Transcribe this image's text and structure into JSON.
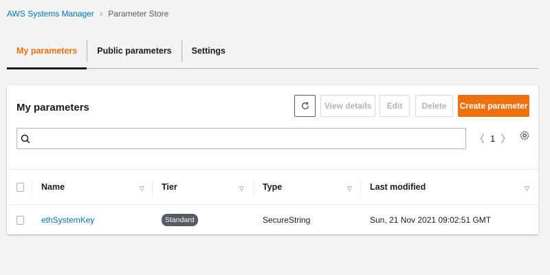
{
  "breadcrumb": {
    "parent": "AWS Systems Manager",
    "current": "Parameter Store"
  },
  "tabs": [
    {
      "label": "My parameters",
      "active": true
    },
    {
      "label": "Public parameters",
      "active": false
    },
    {
      "label": "Settings",
      "active": false
    }
  ],
  "panel": {
    "title": "My parameters",
    "buttons": {
      "view_details": "View details",
      "edit": "Edit",
      "delete": "Delete",
      "create": "Create parameter"
    },
    "search": {
      "placeholder": "",
      "value": ""
    },
    "pagination": {
      "page": "1"
    }
  },
  "table": {
    "columns": [
      "Name",
      "Tier",
      "Type",
      "Last modified"
    ],
    "rows": [
      {
        "name": "ethSystemKey",
        "tier": "Standard",
        "type": "SecureString",
        "last_modified": "Sun, 21 Nov 2021 09:02:51 GMT"
      }
    ]
  },
  "colors": {
    "accent": "#ec7211",
    "link": "#0073bb",
    "background": "#f2f3f3",
    "badge": "#545b64"
  },
  "icons": [
    "chevron-right-icon",
    "refresh-icon",
    "search-icon",
    "chevron-left-icon",
    "settings-icon",
    "sort-down-icon",
    "checkbox"
  ]
}
